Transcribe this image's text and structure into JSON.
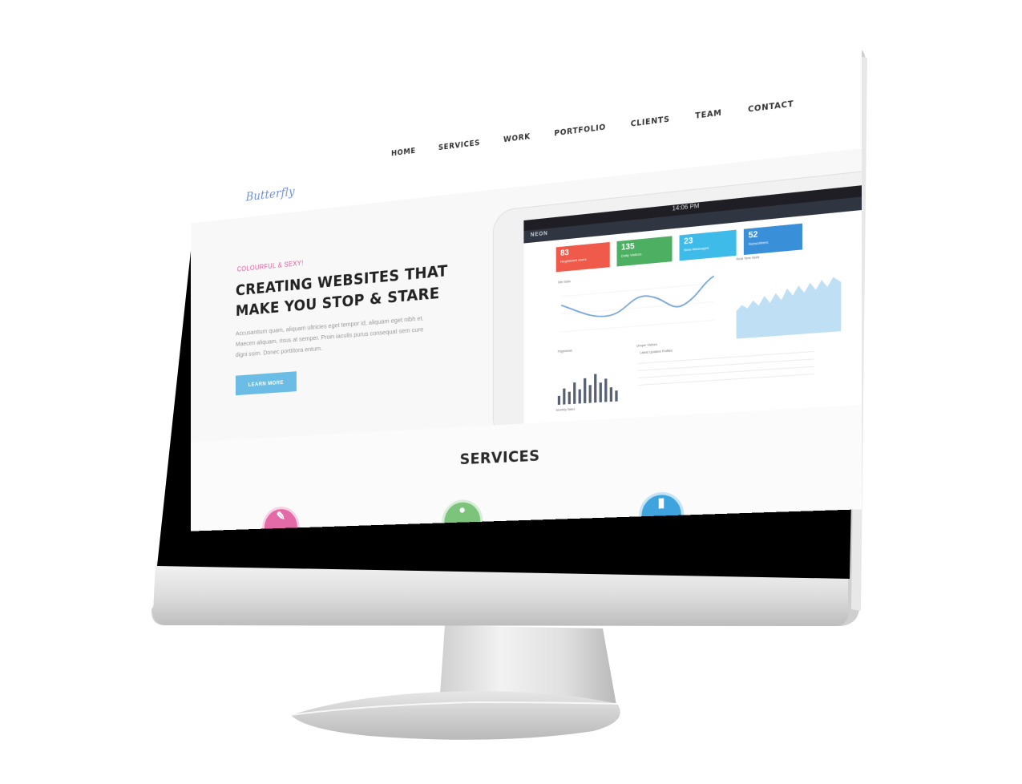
{
  "site": {
    "logo": "Butterfly",
    "nav": [
      "HOME",
      "SERVICES",
      "WORK",
      "PORTFOLIO",
      "CLIENTS",
      "TEAM",
      "CONTACT"
    ],
    "hero": {
      "tagline": "COLOURFUL & SEXY!",
      "headline_line1": "CREATING WEBSITES THAT",
      "headline_line2": "MAKE YOU STOP & STARE",
      "lede": "Accusantium quam, aliquam ultricies eget tempor id, aliquam eget nibh et. Maecen aliquam, risus at semper. Proin iaculis purus consequat sem cure digni ssim. Donec porttitora entum.",
      "cta": "LEARN MORE"
    },
    "services": {
      "title": "SERVICES",
      "icons": [
        "pen-icon",
        "leaf-icon",
        "device-icon"
      ]
    }
  },
  "dashboard": {
    "time": "14:06 PM",
    "brand": "NEON",
    "tiles": [
      {
        "value": "83",
        "label": "Registered users",
        "color": "#f05a4b"
      },
      {
        "value": "135",
        "label": "Daily Visitors",
        "color": "#4caf62"
      },
      {
        "value": "23",
        "label": "New Messages",
        "color": "#3fbbea"
      },
      {
        "value": "52",
        "label": "Subscribers",
        "color": "#3a90d8"
      }
    ],
    "labels": {
      "site_stats": "Site Stats",
      "pageviews": "Pageviews",
      "unique_visitors": "Unique Visitors",
      "real_time": "Real Time Stats",
      "monthly_sales": "Monthly Sales",
      "latest_updated": "Latest Updated Profiles"
    }
  },
  "colors": {
    "accent_pink": "#e0589a",
    "cta_blue": "#6bbde6",
    "svc_pink": "#e46aa7",
    "svc_green": "#7cc47c",
    "svc_blue": "#3fa3de"
  }
}
